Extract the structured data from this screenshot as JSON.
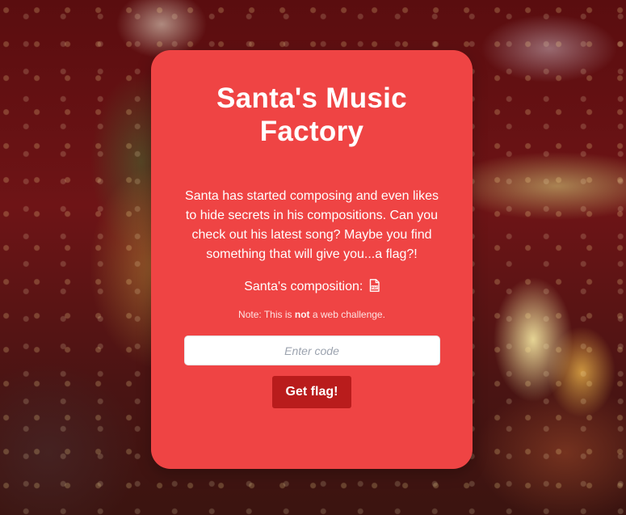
{
  "page": {
    "title": "Santa's Music Factory",
    "description": "Santa has started composing and even likes to hide secrets in his compositions. Can you check out his latest song? Maybe you find something that will give you...a flag?!",
    "composition_label": "Santa's composition:",
    "composition_icon": "file-pdf-icon",
    "note": {
      "prefix": "Note: This is",
      "emphasis": "not",
      "suffix": "a web challenge."
    }
  },
  "form": {
    "code_placeholder": "Enter code",
    "code_value": "",
    "submit_label": "Get flag!"
  },
  "colors": {
    "card_background": "#ef4444",
    "button_background": "#b91c1c",
    "text": "#ffffff"
  }
}
